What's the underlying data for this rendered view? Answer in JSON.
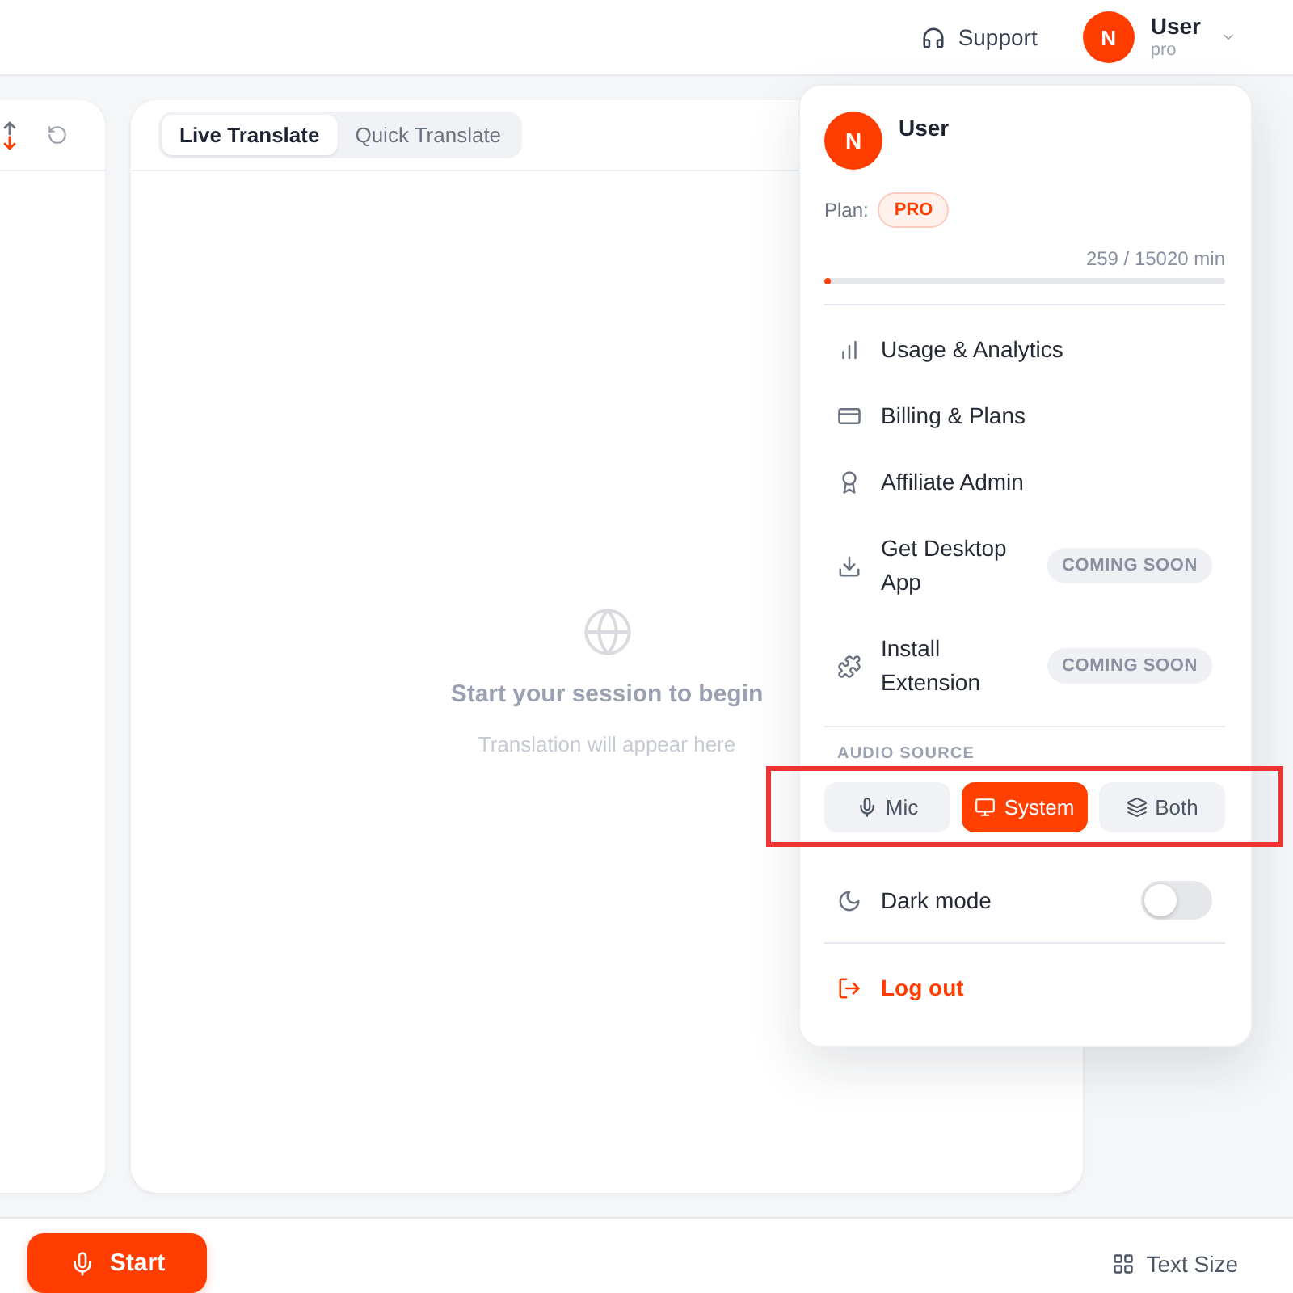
{
  "header": {
    "support": {
      "label": "Support"
    },
    "user": {
      "initial": "N",
      "name": "User",
      "plan": "pro"
    }
  },
  "translate_panel": {
    "tabs": [
      {
        "label": "Live Translate",
        "selected": true
      },
      {
        "label": "Quick Translate",
        "selected": false
      }
    ],
    "empty_state": {
      "title": "Start your session to begin",
      "subtitle": "Translation will appear here"
    }
  },
  "user_menu": {
    "initial": "N",
    "name": "User",
    "plan_label": "Plan:",
    "plan_badge": "PRO",
    "usage_text": "259 / 15020 min",
    "usage_bar": {
      "level": 0.017
    },
    "items": [
      {
        "label": "Usage & Analytics"
      },
      {
        "label": "Billing & Plans"
      },
      {
        "label": "Affiliate Admin"
      },
      {
        "label": "Get Desktop App",
        "badge": "COMING SOON"
      },
      {
        "label": "Install Extension",
        "badge": "COMING SOON"
      }
    ],
    "audio_source": {
      "label": "AUDIO SOURCE",
      "highlighted": true,
      "options": [
        {
          "label": "Mic",
          "selected": false
        },
        {
          "label": "System",
          "selected": true
        },
        {
          "label": "Both",
          "selected": false
        }
      ]
    },
    "dark_mode": {
      "label": "Dark mode",
      "on": false
    },
    "logout": {
      "label": "Log out"
    }
  },
  "footer": {
    "start": "Start",
    "text_size": "Text Size"
  }
}
